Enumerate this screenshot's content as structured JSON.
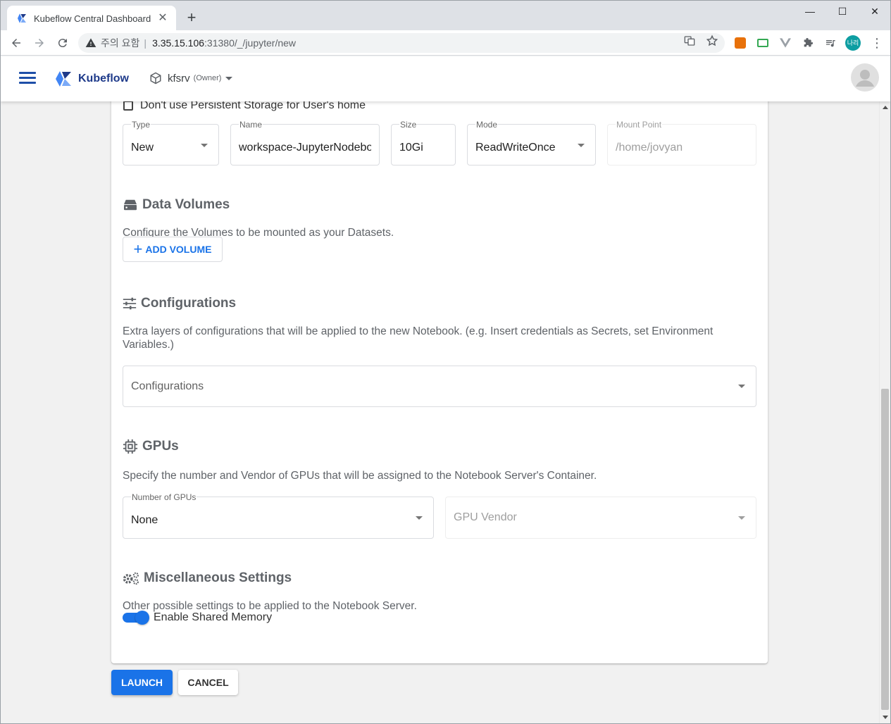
{
  "browser": {
    "tab_title": "Kubeflow Central Dashboard",
    "new_tab": "+",
    "address": {
      "security_label": "주의 요함",
      "separator": "|",
      "host": "3.35.15.106",
      "path": ":31380/_/jupyter/new"
    },
    "profile_initials": "나리",
    "window_controls": {
      "minimize": "—",
      "maximize": "☐",
      "close": "✕"
    }
  },
  "header": {
    "app_name": "Kubeflow",
    "namespace": "kfsrv",
    "namespace_role": "(Owner)"
  },
  "workspace_volume": {
    "checkbox_label": "Don't use Persistent Storage for User's home",
    "checkbox_checked": false,
    "fields": {
      "type": {
        "label": "Type",
        "value": "New"
      },
      "name": {
        "label": "Name",
        "value": "workspace-JupyterNodebook"
      },
      "size": {
        "label": "Size",
        "value": "10Gi"
      },
      "mode": {
        "label": "Mode",
        "value": "ReadWriteOnce"
      },
      "mount_point": {
        "label": "Mount Point",
        "value": "/home/jovyan"
      }
    }
  },
  "data_volumes": {
    "title": "Data Volumes",
    "description": "Configure the Volumes to be mounted as your Datasets.",
    "add_button": "ADD VOLUME"
  },
  "configurations": {
    "title": "Configurations",
    "description": "Extra layers of configurations that will be applied to the new Notebook. (e.g. Insert credentials as Secrets, set Environment Variables.)",
    "select_placeholder": "Configurations"
  },
  "gpus": {
    "title": "GPUs",
    "description": "Specify the number and Vendor of GPUs that will be assigned to the Notebook Server's Container.",
    "number": {
      "label": "Number of GPUs",
      "value": "None"
    },
    "vendor_placeholder": "GPU Vendor"
  },
  "misc": {
    "title": "Miscellaneous Settings",
    "description": "Other possible settings to be applied to the Notebook Server.",
    "shared_memory_label": "Enable Shared Memory",
    "shared_memory_enabled": true
  },
  "actions": {
    "launch": "LAUNCH",
    "cancel": "CANCEL"
  },
  "colors": {
    "accent": "#1a73e8",
    "brand": "#1e3a8a",
    "page_bg": "#f1f1f1"
  }
}
